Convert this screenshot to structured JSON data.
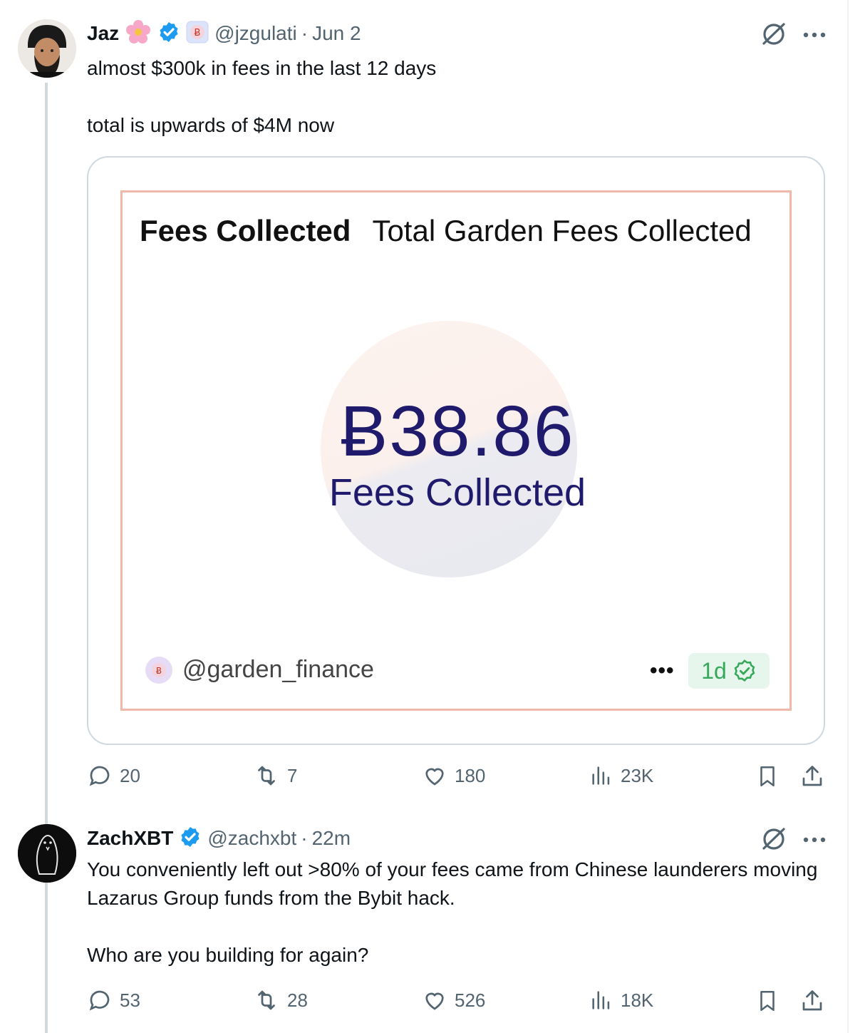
{
  "tweets": [
    {
      "name": "Jaz",
      "handle": "@jzgulati",
      "sep": "·",
      "time": "Jun 2",
      "lines": [
        "almost $300k in fees in the last 12 days",
        "total is upwards of $4M now"
      ],
      "stats": {
        "replies": "20",
        "reposts": "7",
        "likes": "180",
        "views": "23K"
      }
    },
    {
      "name": "ZachXBT",
      "handle": "@zachxbt",
      "sep": "·",
      "time": "22m",
      "lines": [
        "You conveniently left out >80% of your fees came from Chinese launderers moving Lazarus Group funds from the Bybit hack.",
        "Who are you building for again?"
      ],
      "stats": {
        "replies": "53",
        "reposts": "28",
        "likes": "526",
        "views": "18K"
      }
    }
  ],
  "card": {
    "title_bold": "Fees Collected",
    "title_rest": "Total Garden Fees Collected",
    "value": "Ƀ38.86",
    "value_label": "Fees Collected",
    "handle": "@garden_finance",
    "more": "•••",
    "age": "1d"
  },
  "icons": {
    "verified": "verified-badge-icon",
    "grok": "grok-icon",
    "more": "more-icon",
    "reply": "reply-icon",
    "repost": "repost-icon",
    "like": "like-icon",
    "views": "views-icon",
    "bookmark": "bookmark-icon",
    "share": "share-icon"
  },
  "colors": {
    "verified": "#1d9bf0",
    "muted": "#536471",
    "card_value": "#1f1a6b",
    "pill_green": "#36a85a"
  }
}
